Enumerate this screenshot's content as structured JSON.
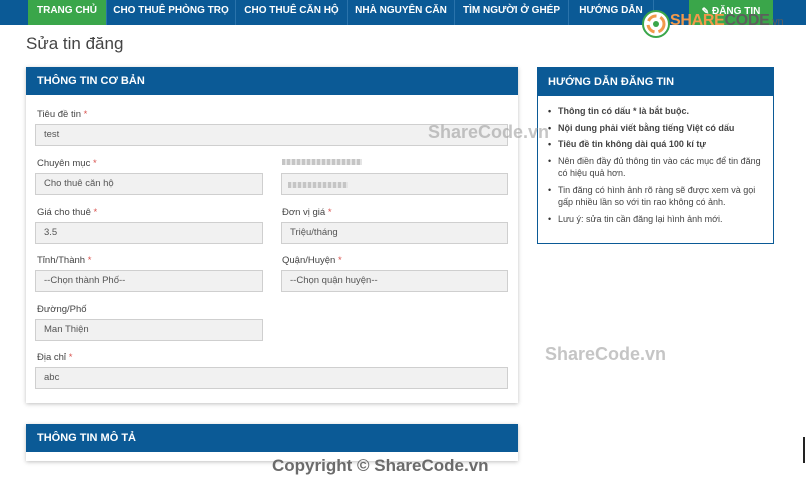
{
  "nav": {
    "items": [
      {
        "label": "TRANG CHỦ",
        "active": true
      },
      {
        "label": "CHO THUÊ PHÒNG TRỌ",
        "active": false
      },
      {
        "label": "CHO THUÊ CĂN HỘ",
        "active": false
      },
      {
        "label": "NHÀ NGUYÊN CĂN",
        "active": false
      },
      {
        "label": "TÌM NGƯỜI Ở GHÉP",
        "active": false
      },
      {
        "label": "HƯỚNG DẪN",
        "active": false
      }
    ],
    "login_label": "ĐĂNG TIN",
    "login_icon": "edit-icon"
  },
  "logo": {
    "share": "SHARE",
    "code": "CODE",
    "domain": ".vn"
  },
  "page": {
    "title": "Sửa tin đăng"
  },
  "basic_info": {
    "heading": "THÔNG TIN CƠ BẢN",
    "required_mark": "*",
    "fields": {
      "title": {
        "label": "Tiêu đề tin",
        "value": "test"
      },
      "category": {
        "label": "Chuyên mục",
        "value": "Cho thuê căn hộ"
      },
      "price": {
        "label": "Giá cho thuê",
        "value": "3.5"
      },
      "unit": {
        "label": "Đơn vị giá",
        "value": "Triệu/tháng"
      },
      "city": {
        "label": "Tỉnh/Thành",
        "value": "--Chọn thành Phố--"
      },
      "district": {
        "label": "Quận/Huyện",
        "value": "--Chọn quận huyện--"
      },
      "street": {
        "label": "Đường/Phố",
        "value": "Man Thiện"
      },
      "address": {
        "label": "Địa chỉ",
        "value": "abc"
      }
    }
  },
  "description": {
    "heading": "THÔNG TIN MÔ TẢ"
  },
  "guide": {
    "heading": "HƯỚNG DẪN ĐĂNG TIN",
    "items": [
      {
        "text": "Thông tin có dấu * là bắt buộc.",
        "bold": true
      },
      {
        "text": "Nội dung phải viết bằng tiếng Việt có dấu",
        "bold": true
      },
      {
        "text": "Tiêu đề tin không dài quá 100 kí tự",
        "bold": true
      },
      {
        "text": "Nên điền đầy đủ thông tin vào các mục để tin đăng có hiệu quả hơn.",
        "bold": false
      },
      {
        "text": "Tin đăng có hình ảnh rõ ràng sẽ được xem và gọi gấp nhiều lần so với tin rao không có ảnh.",
        "bold": false
      },
      {
        "text": "Lưu ý: sửa tin cần đăng lại hình ảnh mới.",
        "bold": false
      }
    ]
  },
  "watermarks": {
    "primary": "ShareCode.vn",
    "copyright": "Copyright © ShareCode.vn"
  }
}
